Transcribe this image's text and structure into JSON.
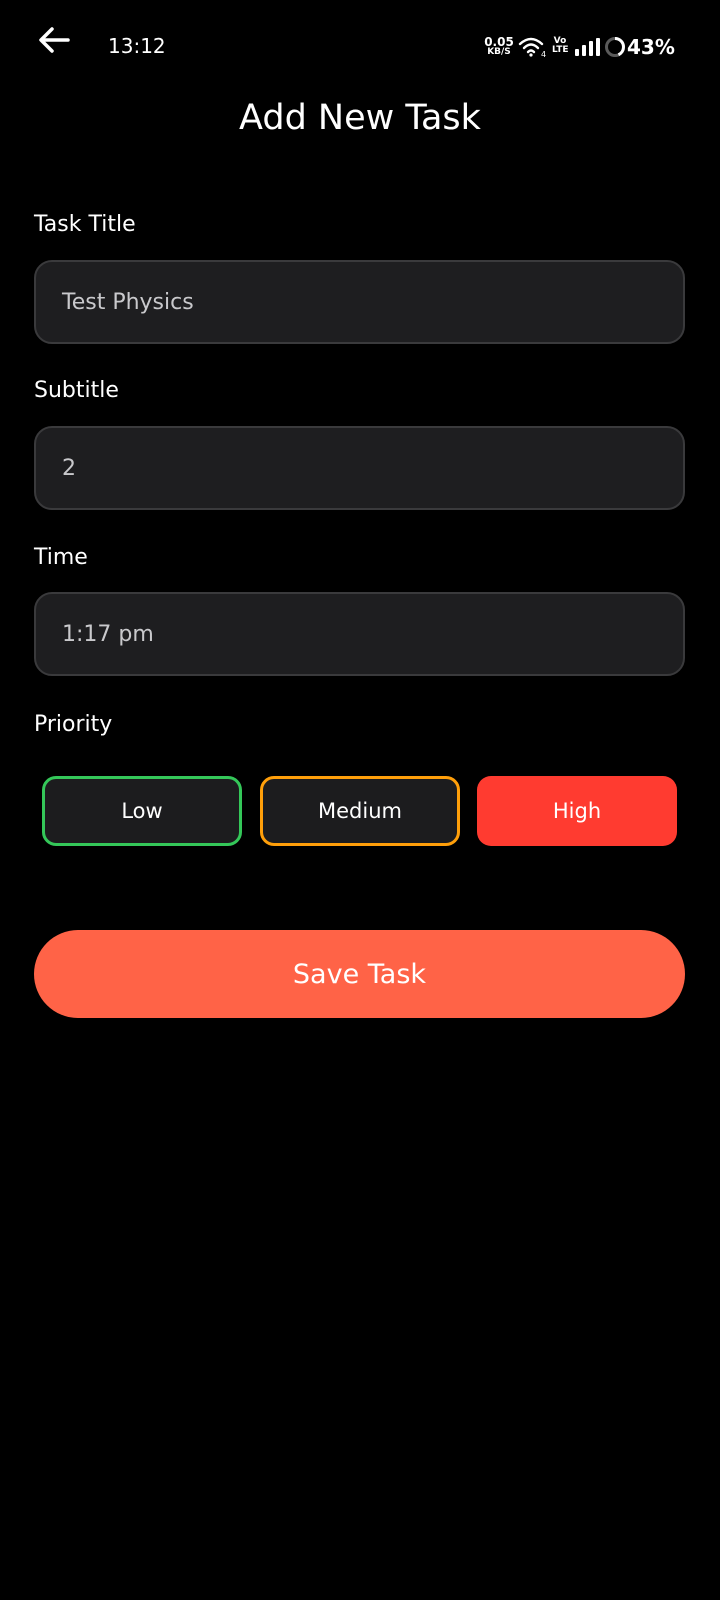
{
  "status_bar": {
    "time": "13:12",
    "net_speed_value": "0.05",
    "net_speed_unit": "KB/S",
    "wifi_badge": "4",
    "volte_top": "Vo",
    "volte_bottom": "LTE",
    "battery_percent": "43%",
    "battery_level": 0.43
  },
  "header": {
    "title": "Add New Task",
    "back_icon": "arrow-left-icon"
  },
  "form": {
    "task_title": {
      "label": "Task Title",
      "value": "Test Physics"
    },
    "subtitle": {
      "label": "Subtitle",
      "value": "2"
    },
    "time": {
      "label": "Time",
      "value": "1:17 pm"
    },
    "priority": {
      "label": "Priority",
      "options": [
        "Low",
        "Medium",
        "High"
      ],
      "selected": "High",
      "colors": {
        "low": "#34c759",
        "medium": "#ff9f0a",
        "high": "#ff3b30"
      }
    }
  },
  "actions": {
    "save_label": "Save Task",
    "save_color": "#ff6347"
  }
}
